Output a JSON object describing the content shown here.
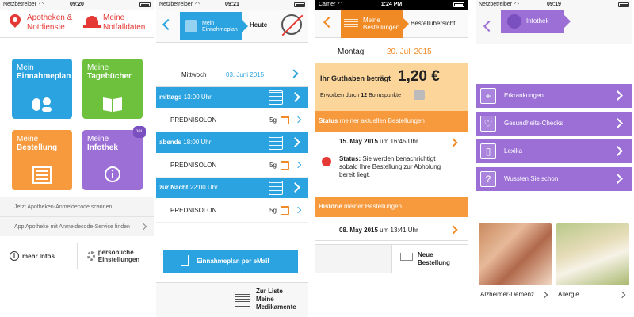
{
  "phone1": {
    "status": {
      "carrier": "Netzbetreiber",
      "time": "09:20"
    },
    "header": {
      "pharmacies": "Apotheken & Notdienste",
      "emergency": "Meine Notfalldaten"
    },
    "tiles": [
      {
        "line1": "Mein",
        "line2": "Einnahmeplan"
      },
      {
        "line1": "Meine",
        "line2": "Tagebücher"
      },
      {
        "line1": "Meine",
        "line2": "Bestellung"
      },
      {
        "line1": "Meine",
        "line2": "Infothek",
        "badge": "neu"
      }
    ],
    "list": [
      "Jetzt Apotheken-Anmeldecode scannen",
      "App Apotheke mit Anmeldecode-Service finden"
    ],
    "bottom": {
      "more_info": "mehr Infos",
      "settings": "persönliche Einstellungen"
    }
  },
  "phone2": {
    "status": {
      "carrier": "Netzbetreiber",
      "time": "09:21"
    },
    "tab": "Mein Einnahmeplan",
    "title": "Heute",
    "date": {
      "day": "Mittwoch",
      "date": "03. Juni 2015"
    },
    "slots": [
      {
        "label": "mittags",
        "time": "13:00 Uhr",
        "med": "PREDNISOLON",
        "dose": "5g"
      },
      {
        "label": "abends",
        "time": "18:00 Uhr",
        "med": "PREDNISOLON",
        "dose": "5g"
      },
      {
        "label": "zur Nacht",
        "time": "22:00 Uhr",
        "med": "PREDNISOLON",
        "dose": "5g"
      }
    ],
    "email_button": "Einnahmeplan per eMail",
    "bottom": {
      "line1": "Zur Liste",
      "line2": "Meine",
      "line3": "Medikamente"
    }
  },
  "phone3": {
    "status": {
      "carrier": "Carrier",
      "time": "1:24 PM"
    },
    "tab": {
      "line1": "Meine",
      "line2": "Bestellungen"
    },
    "title": "Bestellübersicht",
    "date": {
      "day": "Montag",
      "date": "20. Juli 2015"
    },
    "credit": {
      "label": "Ihr Guthaben beträgt",
      "amount": "1,20 €",
      "earned_pre": "Erworben durch",
      "earned_num": "12",
      "earned_post": "Bonuspunkte"
    },
    "status_band": {
      "bold": "Status",
      "rest": "meiner aktuellen Bestellungen"
    },
    "current_order": {
      "date": "15. May 2015",
      "time": "um 16:45 Uhr",
      "status_label": "Status:",
      "status_text": "Sie werden benachrichtigt sobald Ihre Bestellung zur Abholung bereit liegt."
    },
    "history_band": {
      "bold": "Historie",
      "rest": "meiner Bestellungen"
    },
    "history_order": {
      "date": "08. May 2015",
      "time": "um 13:41 Uhr"
    },
    "new_order": {
      "line1": "Neue",
      "line2": "Bestellung"
    }
  },
  "phone4": {
    "status": {
      "carrier": "Netzbetreiber",
      "time": "09:19"
    },
    "tab": "Infothek",
    "categories": [
      {
        "label": "Erkrankungen",
        "icon": "plus-icon"
      },
      {
        "label": "Gesundheits-Checks",
        "icon": "heart-icon"
      },
      {
        "label": "Lexika",
        "icon": "book-icon"
      },
      {
        "label": "Wussten Sie schon",
        "icon": "question-icon"
      }
    ],
    "photos": [
      {
        "caption": "Alzheimer-Demenz"
      },
      {
        "caption": "Allergie"
      }
    ]
  },
  "colors": {
    "blue": "#2ba3e0",
    "green": "#6dc13d",
    "orange": "#f79a3e",
    "purple": "#9c6fd6",
    "red": "#e53935"
  }
}
